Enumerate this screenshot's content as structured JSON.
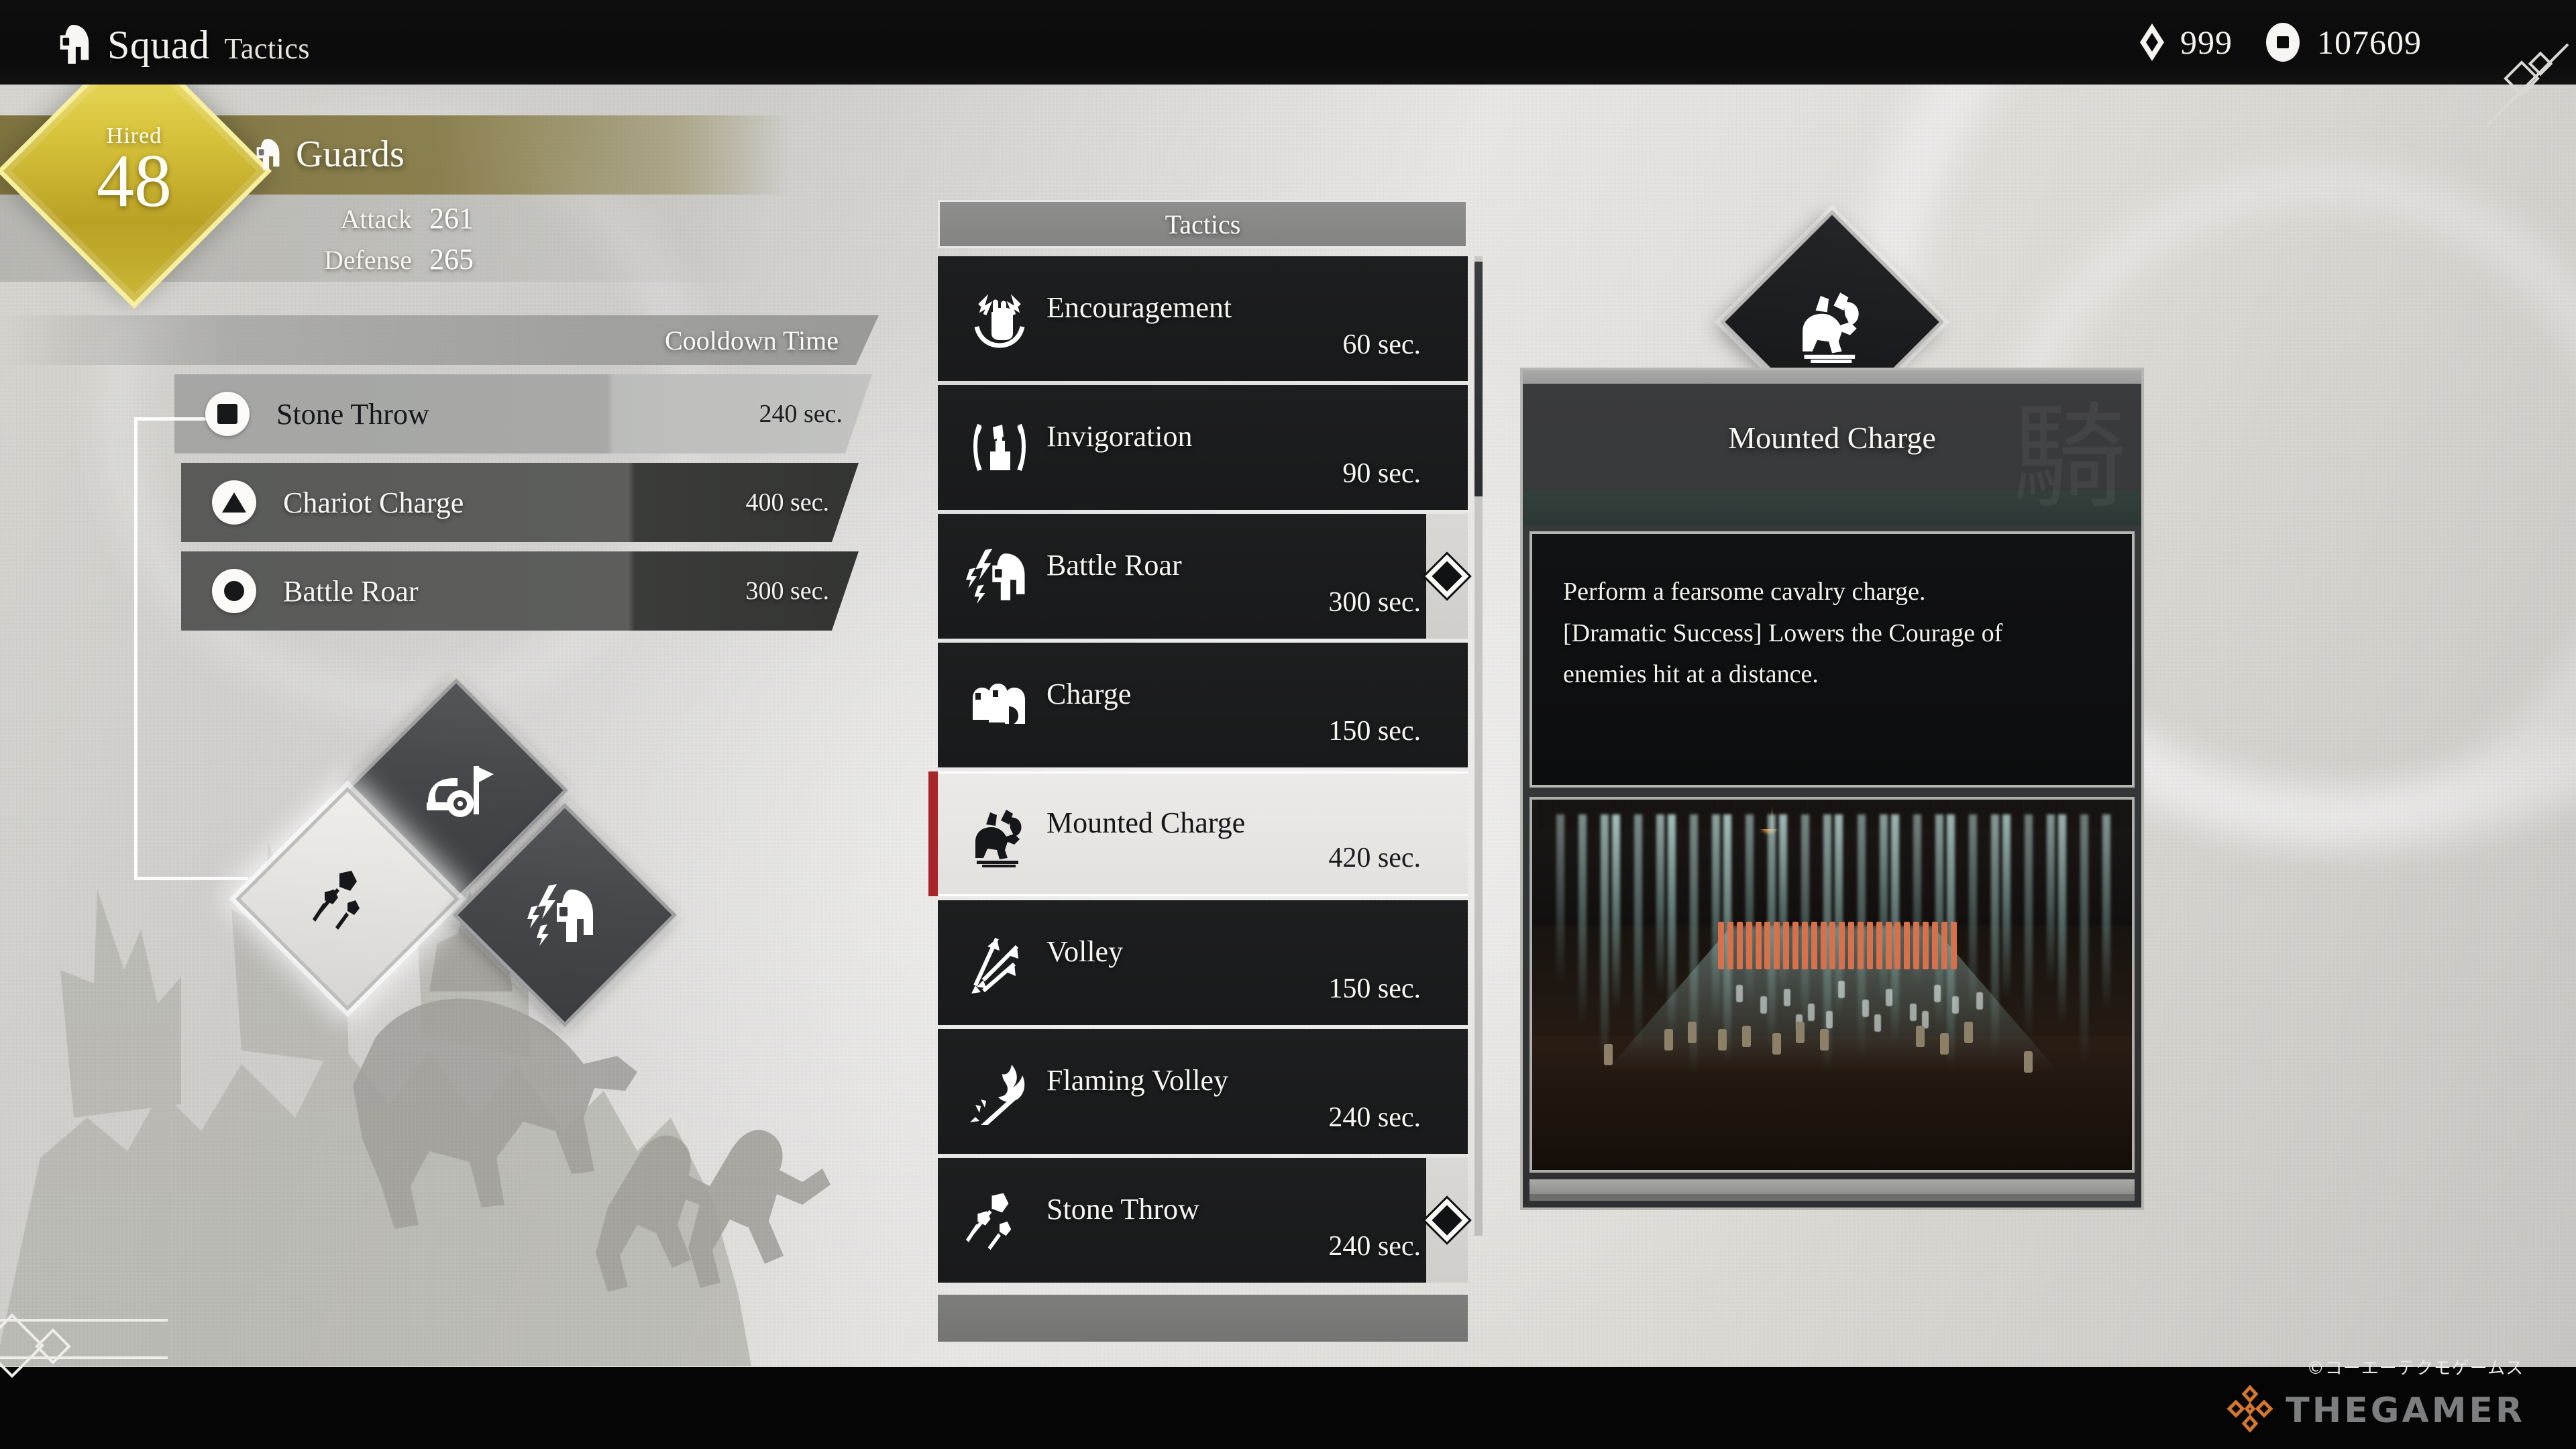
{
  "header": {
    "icon": "helmet-icon",
    "title": "Squad",
    "subtitle": "Tactics",
    "currencies": [
      {
        "icon": "gem-icon",
        "value": "999"
      },
      {
        "icon": "coin-icon",
        "value": "107609"
      }
    ]
  },
  "squad": {
    "hired_label": "Hired",
    "hired_value": "48",
    "icon": "helmet-icon",
    "name": "Guards",
    "stats": [
      {
        "label": "Attack",
        "value": "261"
      },
      {
        "label": "Defense",
        "value": "265"
      }
    ]
  },
  "cooldown": {
    "header": "Cooldown Time",
    "rows": [
      {
        "button": "square",
        "name": "Stone Throw",
        "time": "240 sec.",
        "active": true
      },
      {
        "button": "triangle",
        "name": "Chariot Charge",
        "time": "400 sec.",
        "active": false
      },
      {
        "button": "circle",
        "name": "Battle Roar",
        "time": "300 sec.",
        "active": false
      }
    ]
  },
  "slots": [
    {
      "icon": "chariot-flag-icon",
      "name": "Chariot Charge",
      "selected": false,
      "position": "top"
    },
    {
      "icon": "stone-throw-icon",
      "name": "Stone Throw",
      "selected": true,
      "position": "left"
    },
    {
      "icon": "battle-roar-icon",
      "name": "Battle Roar",
      "selected": false,
      "position": "right"
    }
  ],
  "tactics": {
    "header": "Tactics",
    "items": [
      {
        "icon": "fist-laurel-icon",
        "name": "Encouragement",
        "time": "60 sec.",
        "selected": false,
        "equipped": false
      },
      {
        "icon": "raised-arm-icon",
        "name": "Invigoration",
        "time": "90 sec.",
        "selected": false,
        "equipped": false
      },
      {
        "icon": "battle-roar-icon",
        "name": "Battle Roar",
        "time": "300 sec.",
        "selected": false,
        "equipped": true
      },
      {
        "icon": "soldiers-icon",
        "name": "Charge",
        "time": "150 sec.",
        "selected": false,
        "equipped": false
      },
      {
        "icon": "cavalry-icon",
        "name": "Mounted Charge",
        "time": "420 sec.",
        "selected": true,
        "equipped": false
      },
      {
        "icon": "arrows-icon",
        "name": "Volley",
        "time": "150 sec.",
        "selected": false,
        "equipped": false
      },
      {
        "icon": "flaming-arrow-icon",
        "name": "Flaming Volley",
        "time": "240 sec.",
        "selected": false,
        "equipped": false
      },
      {
        "icon": "stone-throw-icon",
        "name": "Stone Throw",
        "time": "240 sec.",
        "selected": false,
        "equipped": true
      }
    ]
  },
  "detail": {
    "icon": "cavalry-icon",
    "title": "Mounted Charge",
    "kanji": "騎",
    "description_lines": [
      "Perform a fearsome cavalry charge.",
      "[Dramatic Success] Lowers the Courage of",
      "enemies hit at a distance."
    ],
    "preview_alt": "mounted-charge-preview"
  },
  "watermark": {
    "brand": "THEGAMER",
    "copyright": "©コーエーテクモゲームス"
  },
  "colors": {
    "accent_red": "#a8252b",
    "hired_gold": "#d8c43c",
    "brand_orange": "#d4772c",
    "teal_bar": "#33403c",
    "panel_dark": "#191a1b"
  }
}
